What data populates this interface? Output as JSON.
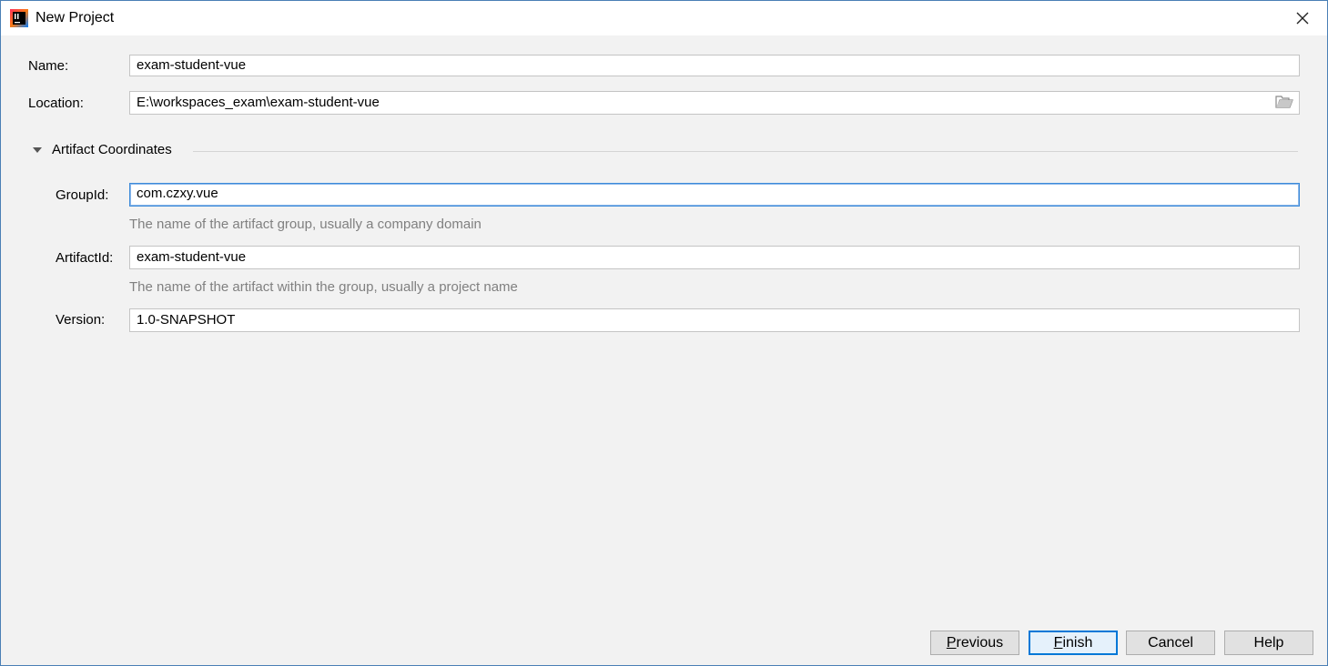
{
  "window": {
    "title": "New Project"
  },
  "form": {
    "name": {
      "label": "Name:",
      "value": "exam-student-vue"
    },
    "location": {
      "label": "Location:",
      "value": "E:\\workspaces_exam\\exam-student-vue"
    },
    "section": {
      "title": "Artifact Coordinates",
      "expanded": true
    },
    "group_id": {
      "label": "GroupId:",
      "value": "com.czxy.vue",
      "hint": "The name of the artifact group, usually a company domain"
    },
    "artifact_id": {
      "label": "ArtifactId:",
      "value": "exam-student-vue",
      "hint": "The name of the artifact within the group, usually a project name"
    },
    "version": {
      "label": "Version:",
      "value": "1.0-SNAPSHOT"
    }
  },
  "buttons": {
    "previous": {
      "mnemonic": "P",
      "rest": "revious"
    },
    "finish": {
      "mnemonic": "F",
      "rest": "inish"
    },
    "cancel": "Cancel",
    "help": "Help"
  },
  "icons": {
    "app": "intellij-idea-icon",
    "close": "close-icon",
    "folder": "folder-open-icon",
    "expand": "triangle-down-icon"
  },
  "colors": {
    "accent": "#0078d7",
    "focus_border": "#3c8ad9",
    "hint_text": "#808080",
    "dialog_bg": "#f2f2f2"
  }
}
